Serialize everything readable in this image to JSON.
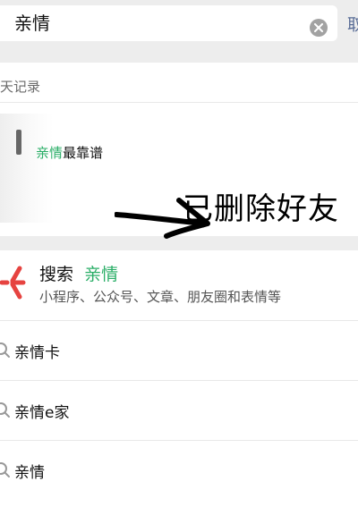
{
  "search": {
    "query": "亲情",
    "cancel_label": "取消"
  },
  "chat_section": {
    "title": "聊天记录",
    "visible_title": "天记录",
    "chat": {
      "title_highlight": "亲情",
      "title_rest": "最靠谱"
    },
    "annotation": "已删除好友"
  },
  "search_one": {
    "prefix": "搜索",
    "keyword": "亲情",
    "subtitle": "小程序、公众号、文章、朋友圈和表情等"
  },
  "suggestions": [
    {
      "label": "亲情卡"
    },
    {
      "label": "亲情e家"
    },
    {
      "label": "亲情"
    }
  ],
  "colors": {
    "highlight": "#2aae67",
    "link": "#576b95",
    "background": "#ededed"
  }
}
